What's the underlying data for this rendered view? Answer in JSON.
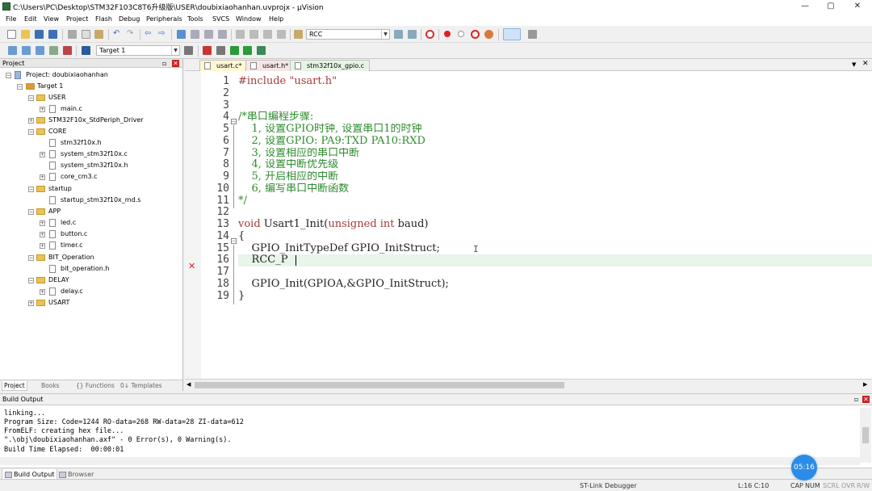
{
  "window": {
    "title": "C:\\Users\\PC\\Desktop\\STM32F103C8T6升级版\\USER\\doubixiaohanhan.uvprojx - µVision",
    "minimize": "—",
    "maximize": "▢",
    "close": "✕"
  },
  "menu": [
    "File",
    "Edit",
    "View",
    "Project",
    "Flash",
    "Debug",
    "Peripherals",
    "Tools",
    "SVCS",
    "Window",
    "Help"
  ],
  "toolbar": {
    "find_value": "RCC",
    "target_value": "Target 1"
  },
  "project_panel": {
    "title": "Project",
    "tree": [
      {
        "label": "Project: doubixiaohanhan"
      },
      {
        "label": "Target 1"
      },
      {
        "label": "USER"
      },
      {
        "label": "main.c"
      },
      {
        "label": "STM32F10x_StdPeriph_Driver"
      },
      {
        "label": "CORE"
      },
      {
        "label": "stm32f10x.h"
      },
      {
        "label": "system_stm32f10x.c"
      },
      {
        "label": "system_stm32f10x.h"
      },
      {
        "label": "core_cm3.c"
      },
      {
        "label": "startup"
      },
      {
        "label": "startup_stm32f10x_md.s"
      },
      {
        "label": "APP"
      },
      {
        "label": "led.c"
      },
      {
        "label": "button.c"
      },
      {
        "label": "timer.c"
      },
      {
        "label": "BIT_Operation"
      },
      {
        "label": "bit_operation.h"
      },
      {
        "label": "DELAY"
      },
      {
        "label": "delay.c"
      },
      {
        "label": "USART"
      }
    ],
    "tabs": [
      "Project",
      "Books",
      "{} Functions",
      "0↓ Templates"
    ]
  },
  "editor": {
    "tabs": [
      "usart.c*",
      "usart.h*",
      "stm32f10x_gpio.c"
    ],
    "line_numbers": [
      "1",
      "2",
      "3",
      "4",
      "5",
      "6",
      "7",
      "8",
      "9",
      "10",
      "11",
      "12",
      "13",
      "14",
      "15",
      "16",
      "17",
      "18",
      "19"
    ],
    "lines": [
      {
        "k": "pp",
        "t": "#include \"usart.h\""
      },
      {
        "k": "plain",
        "t": ""
      },
      {
        "k": "plain",
        "t": ""
      },
      {
        "k": "cm",
        "t": "/*串口编程步骤:"
      },
      {
        "k": "cm",
        "t": "    1, 设置GPIO时钟, 设置串口1的时钟"
      },
      {
        "k": "cm",
        "t": "    2, 设置GPIO: PA9:TXD PA10:RXD"
      },
      {
        "k": "cm",
        "t": "    3, 设置相应的串口中断"
      },
      {
        "k": "cm",
        "t": "    4, 设置中断优先级"
      },
      {
        "k": "cm",
        "t": "    5, 开启相应的中断"
      },
      {
        "k": "cm",
        "t": "    6, 编写串口中断函数"
      },
      {
        "k": "cm",
        "t": "*/"
      },
      {
        "k": "plain",
        "t": ""
      },
      {
        "k": "fn",
        "t": "Usart1_Init"
      },
      {
        "k": "plain",
        "t": "{"
      },
      {
        "k": "plain",
        "t": "    GPIO_InitTypeDef GPIO_InitStruct;"
      },
      {
        "k": "plain",
        "t": "    RCC_P"
      },
      {
        "k": "plain",
        "t": ""
      },
      {
        "k": "plain",
        "t": "    GPIO_Init(GPIOA,&GPIO_InitStruct);"
      },
      {
        "k": "plain",
        "t": "}"
      }
    ],
    "func_kw_void": "void ",
    "func_name": "Usart1_Init(",
    "func_kw_unsigned": "unsigned int",
    "func_tail": " baud)",
    "error_marker": "✕"
  },
  "build_output": {
    "title": "Build Output",
    "lines": [
      "linking...",
      "Program Size: Code=1244 RO-data=268 RW-data=28 ZI-data=612",
      "FromELF: creating hex file...",
      "\".\\obj\\doubixiaohanhan.axf\" - 0 Error(s), 0 Warning(s).",
      "Build Time Elapsed:  00:00:01"
    ],
    "tabs": [
      "Build Output",
      "Browser"
    ]
  },
  "status": {
    "debugger": "ST-Link Debugger",
    "position": "L:16 C:10",
    "caps": "CAP",
    "num": "NUM",
    "scrl": "SCRL",
    "ovr": "OVR",
    "rw": "R/W"
  },
  "timer_overlay": "05:16"
}
